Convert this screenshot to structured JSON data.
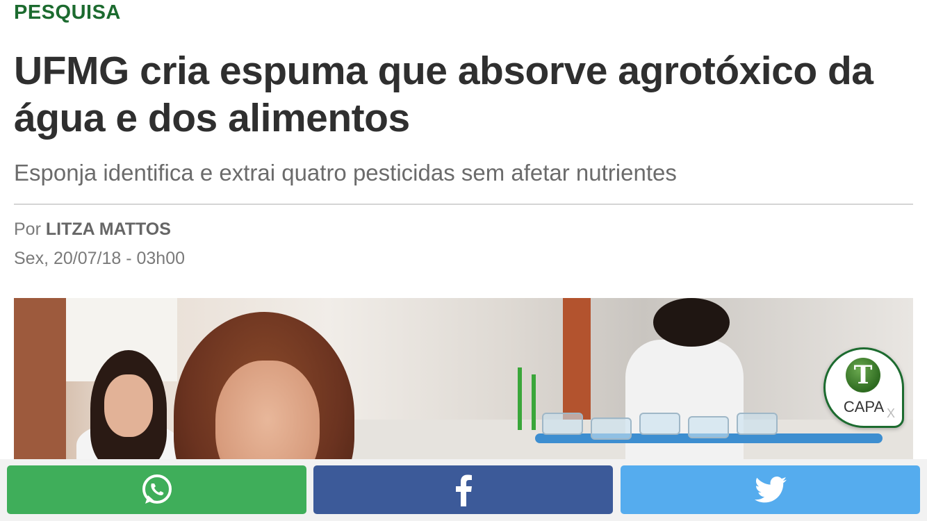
{
  "article": {
    "section": "PESQUISA",
    "title": "UFMG cria espuma que absorve agrotóxico da água e dos alimentos",
    "subtitle": "Esponja identifica e extrai quatro pesticidas sem afetar nutrientes",
    "byline_prefix": "Por",
    "author": "LITZA MATTOS",
    "date": "Sex, 20/07/18 - 03h00"
  },
  "capa_badge": {
    "logo_letter": "T",
    "label": "CAPA",
    "close": "X"
  },
  "share": {
    "buttons": [
      {
        "icon": "whatsapp-icon",
        "color": "#3fae5a"
      },
      {
        "icon": "facebook-icon",
        "color": "#3c5a99"
      },
      {
        "icon": "twitter-icon",
        "color": "#55acee"
      }
    ]
  },
  "colors": {
    "section_green": "#1c6b2f",
    "title": "#2f2f2f",
    "meta_gray": "#7a7a7a"
  }
}
